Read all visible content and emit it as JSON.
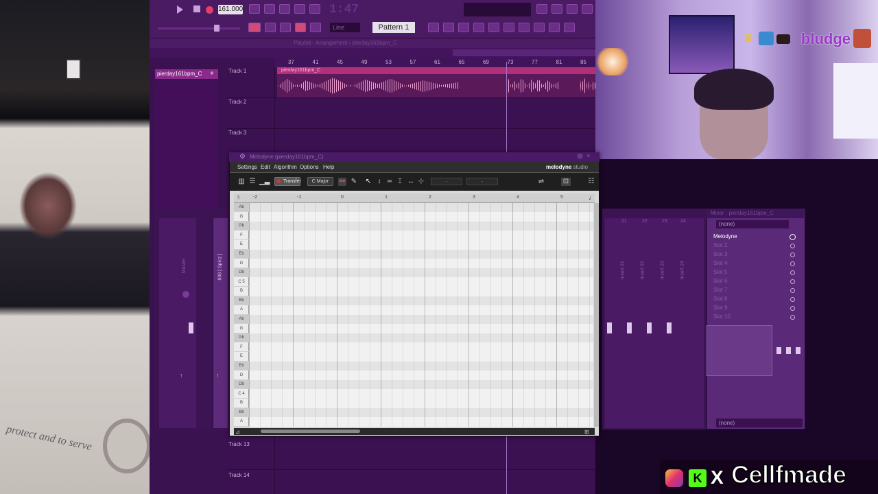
{
  "fl_studio": {
    "tempo": "161.000",
    "song_time": "1:47",
    "line_mode": "Line",
    "pattern": "Pattern 1",
    "pattern_list_item": "pierday161bpm_C",
    "playlist_title": "Playlist - Arrangement › pierday161bpm_C",
    "ruler_bars": [
      "37",
      "41",
      "45",
      "49",
      "53",
      "57",
      "61",
      "65",
      "69",
      "73",
      "77",
      "81",
      "85"
    ],
    "tracks": [
      "Track 1",
      "Track 2",
      "Track 3",
      "Track 13",
      "Track 14"
    ],
    "clip_name": "pierday161bpm_C",
    "mixer_left_labels": [
      "Master",
      "808 [ Spinz ]"
    ],
    "mixer_right_labels": [
      "Insert 21",
      "Insert 22",
      "Insert 23",
      "Insert 24"
    ],
    "mixer_right_numbers": [
      "21",
      "22",
      "23",
      "24"
    ]
  },
  "fx_panel": {
    "title": "Mixer - pierday161bpm_C",
    "input": "(none)",
    "slots": [
      "Melodyne",
      "Slot 2",
      "Slot 3",
      "Slot 4",
      "Slot 5",
      "Slot 6",
      "Slot 7",
      "Slot 8",
      "Slot 9",
      "Slot 10"
    ],
    "output": "(none)"
  },
  "melodyne": {
    "title": "Melodyne (pierday161bpm_C)",
    "menu": [
      "Settings",
      "Edit",
      "Algorithm",
      "Options",
      "Help"
    ],
    "logo": "melodyne",
    "logo_edition": "studio",
    "transfer_label": "Transfer",
    "key": "C Major",
    "field_a": "-",
    "field_b": "-",
    "ruler": [
      "-2",
      "-1",
      "0",
      "1",
      "2",
      "3",
      "4",
      "5"
    ],
    "keys": [
      "Ab",
      "G",
      "Gb",
      "F",
      "E",
      "Eb",
      "D",
      "Db",
      "C 5",
      "B",
      "Bb",
      "A",
      "Ab",
      "G",
      "Gb",
      "F",
      "E",
      "Eb",
      "D",
      "Db",
      "C 4",
      "B",
      "Bb",
      "A"
    ]
  },
  "overlay": {
    "webcam_username": "bludge",
    "brand_name": "Cellfmade",
    "brand_x": "X",
    "brand_k": "K",
    "photo_text": "protect and to serve"
  }
}
